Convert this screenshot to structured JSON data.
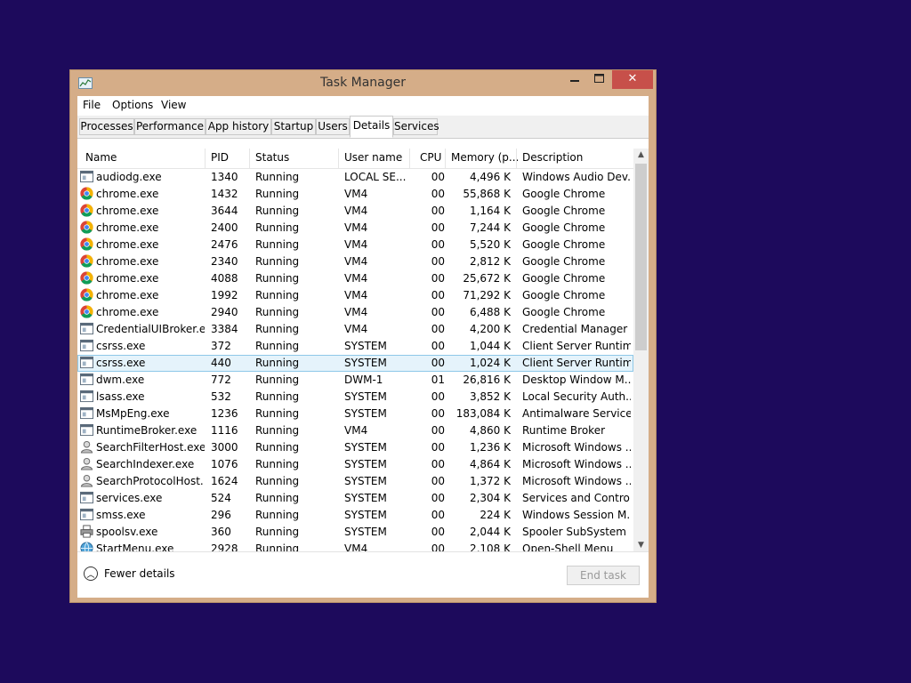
{
  "window": {
    "title": "Task Manager"
  },
  "menu": [
    "File",
    "Options",
    "View"
  ],
  "tabs": [
    "Processes",
    "Performance",
    "App history",
    "Startup",
    "Users",
    "Details",
    "Services"
  ],
  "active_tab": "Details",
  "columns": [
    "Name",
    "PID",
    "Status",
    "User name",
    "CPU",
    "Memory (p...",
    "Description"
  ],
  "rows": [
    {
      "icon": "system-app-icon",
      "name": "audiodg.exe",
      "pid": "1340",
      "status": "Running",
      "user": "LOCAL SE...",
      "cpu": "00",
      "mem": "4,496 K",
      "desc": "Windows Audio Dev..."
    },
    {
      "icon": "chrome-icon",
      "name": "chrome.exe",
      "pid": "1432",
      "status": "Running",
      "user": "VM4",
      "cpu": "00",
      "mem": "55,868 K",
      "desc": "Google Chrome"
    },
    {
      "icon": "chrome-icon",
      "name": "chrome.exe",
      "pid": "3644",
      "status": "Running",
      "user": "VM4",
      "cpu": "00",
      "mem": "1,164 K",
      "desc": "Google Chrome"
    },
    {
      "icon": "chrome-icon",
      "name": "chrome.exe",
      "pid": "2400",
      "status": "Running",
      "user": "VM4",
      "cpu": "00",
      "mem": "7,244 K",
      "desc": "Google Chrome"
    },
    {
      "icon": "chrome-icon",
      "name": "chrome.exe",
      "pid": "2476",
      "status": "Running",
      "user": "VM4",
      "cpu": "00",
      "mem": "5,520 K",
      "desc": "Google Chrome"
    },
    {
      "icon": "chrome-icon",
      "name": "chrome.exe",
      "pid": "2340",
      "status": "Running",
      "user": "VM4",
      "cpu": "00",
      "mem": "2,812 K",
      "desc": "Google Chrome"
    },
    {
      "icon": "chrome-icon",
      "name": "chrome.exe",
      "pid": "4088",
      "status": "Running",
      "user": "VM4",
      "cpu": "00",
      "mem": "25,672 K",
      "desc": "Google Chrome"
    },
    {
      "icon": "chrome-icon",
      "name": "chrome.exe",
      "pid": "1992",
      "status": "Running",
      "user": "VM4",
      "cpu": "00",
      "mem": "71,292 K",
      "desc": "Google Chrome"
    },
    {
      "icon": "chrome-icon",
      "name": "chrome.exe",
      "pid": "2940",
      "status": "Running",
      "user": "VM4",
      "cpu": "00",
      "mem": "6,488 K",
      "desc": "Google Chrome"
    },
    {
      "icon": "system-app-icon",
      "name": "CredentialUIBroker.exe",
      "pid": "3384",
      "status": "Running",
      "user": "VM4",
      "cpu": "00",
      "mem": "4,200 K",
      "desc": "Credential Manager ..."
    },
    {
      "icon": "system-app-icon",
      "name": "csrss.exe",
      "pid": "372",
      "status": "Running",
      "user": "SYSTEM",
      "cpu": "00",
      "mem": "1,044 K",
      "desc": "Client Server Runtim..."
    },
    {
      "icon": "system-app-icon",
      "name": "csrss.exe",
      "pid": "440",
      "status": "Running",
      "user": "SYSTEM",
      "cpu": "00",
      "mem": "1,024 K",
      "desc": "Client Server Runtim...",
      "selected": true
    },
    {
      "icon": "system-app-icon",
      "name": "dwm.exe",
      "pid": "772",
      "status": "Running",
      "user": "DWM-1",
      "cpu": "01",
      "mem": "26,816 K",
      "desc": "Desktop Window M..."
    },
    {
      "icon": "system-app-icon",
      "name": "lsass.exe",
      "pid": "532",
      "status": "Running",
      "user": "SYSTEM",
      "cpu": "00",
      "mem": "3,852 K",
      "desc": "Local Security Auth..."
    },
    {
      "icon": "system-app-icon",
      "name": "MsMpEng.exe",
      "pid": "1236",
      "status": "Running",
      "user": "SYSTEM",
      "cpu": "00",
      "mem": "183,084 K",
      "desc": "Antimalware Service..."
    },
    {
      "icon": "system-app-icon",
      "name": "RuntimeBroker.exe",
      "pid": "1116",
      "status": "Running",
      "user": "VM4",
      "cpu": "00",
      "mem": "4,860 K",
      "desc": "Runtime Broker"
    },
    {
      "icon": "search-person-icon",
      "name": "SearchFilterHost.exe",
      "pid": "3000",
      "status": "Running",
      "user": "SYSTEM",
      "cpu": "00",
      "mem": "1,236 K",
      "desc": "Microsoft Windows ..."
    },
    {
      "icon": "search-person-icon",
      "name": "SearchIndexer.exe",
      "pid": "1076",
      "status": "Running",
      "user": "SYSTEM",
      "cpu": "00",
      "mem": "4,864 K",
      "desc": "Microsoft Windows ..."
    },
    {
      "icon": "search-person-icon",
      "name": "SearchProtocolHost....",
      "pid": "1624",
      "status": "Running",
      "user": "SYSTEM",
      "cpu": "00",
      "mem": "1,372 K",
      "desc": "Microsoft Windows ..."
    },
    {
      "icon": "system-app-icon",
      "name": "services.exe",
      "pid": "524",
      "status": "Running",
      "user": "SYSTEM",
      "cpu": "00",
      "mem": "2,304 K",
      "desc": "Services and Control..."
    },
    {
      "icon": "system-app-icon",
      "name": "smss.exe",
      "pid": "296",
      "status": "Running",
      "user": "SYSTEM",
      "cpu": "00",
      "mem": "224 K",
      "desc": "Windows Session M..."
    },
    {
      "icon": "printer-icon",
      "name": "spoolsv.exe",
      "pid": "360",
      "status": "Running",
      "user": "SYSTEM",
      "cpu": "00",
      "mem": "2,044 K",
      "desc": "Spooler SubSystem ..."
    },
    {
      "icon": "globe-icon",
      "name": "StartMenu.exe",
      "pid": "2928",
      "status": "Running",
      "user": "VM4",
      "cpu": "00",
      "mem": "2,108 K",
      "desc": "Open-Shell Menu"
    }
  ],
  "footer": {
    "fewer_details": "Fewer details",
    "end_task": "End task"
  },
  "colors": {
    "desktop": "#1d0a5c",
    "frame": "#d5ad88",
    "close": "#c7504a",
    "selection": "#e5f3fb"
  }
}
